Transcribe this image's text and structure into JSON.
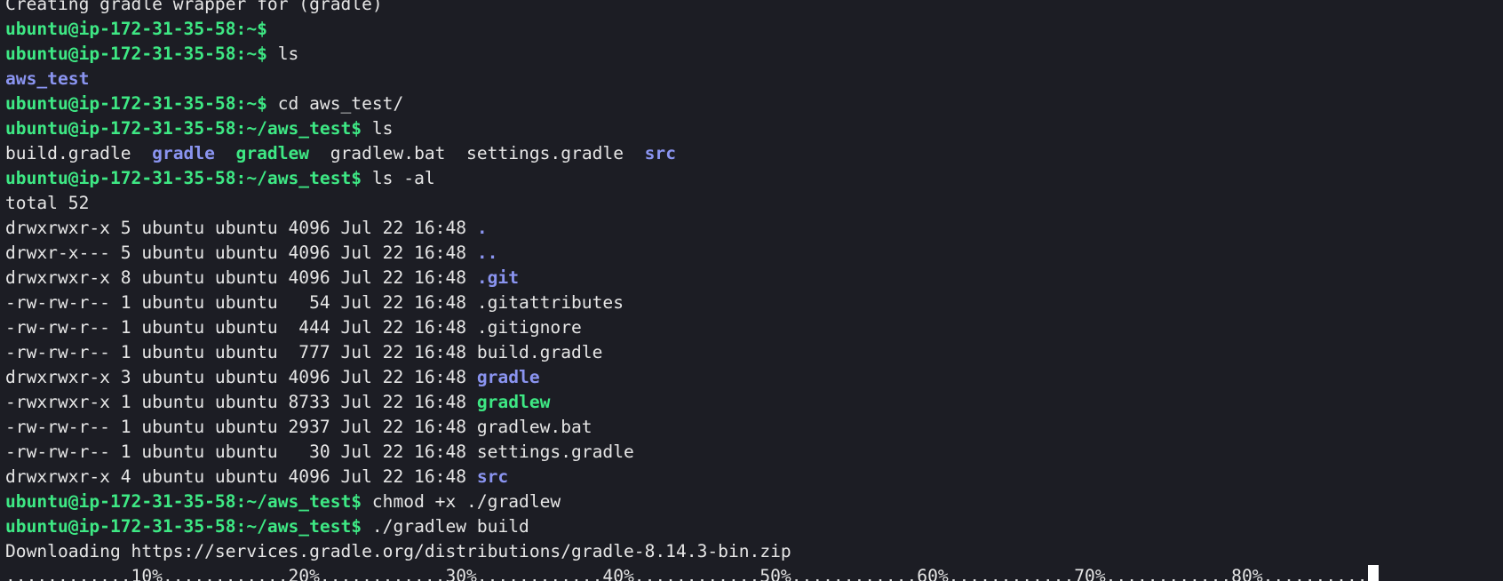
{
  "terminal": {
    "prompt_home": "ubuntu@ip-172-31-35-58:~$",
    "prompt_proj": "ubuntu@ip-172-31-35-58:~/aws_test$",
    "lines": [
      {
        "type": "cut",
        "text": "Creating gradle wrapper for (gradle)"
      },
      {
        "type": "prompt",
        "prompt": "ubuntu@ip-172-31-35-58:~$",
        "cmd": ""
      },
      {
        "type": "prompt",
        "prompt": "ubuntu@ip-172-31-35-58:~$",
        "cmd": " ls"
      },
      {
        "type": "output",
        "segments": [
          {
            "text": "aws_test",
            "style": "dir"
          }
        ]
      },
      {
        "type": "prompt",
        "prompt": "ubuntu@ip-172-31-35-58:~$",
        "cmd": " cd aws_test/"
      },
      {
        "type": "prompt",
        "prompt": "ubuntu@ip-172-31-35-58:~/aws_test$",
        "cmd": " ls"
      },
      {
        "type": "output",
        "segments": [
          {
            "text": "build.gradle  ",
            "style": "plain"
          },
          {
            "text": "gradle",
            "style": "dir"
          },
          {
            "text": "  ",
            "style": "plain"
          },
          {
            "text": "gradlew",
            "style": "exec"
          },
          {
            "text": "  gradlew.bat  settings.gradle  ",
            "style": "plain"
          },
          {
            "text": "src",
            "style": "dir"
          }
        ]
      },
      {
        "type": "prompt",
        "prompt": "ubuntu@ip-172-31-35-58:~/aws_test$",
        "cmd": " ls -al"
      },
      {
        "type": "output",
        "segments": [
          {
            "text": "total 52",
            "style": "plain"
          }
        ]
      },
      {
        "type": "listing",
        "meta": "drwxrwxr-x 5 ubuntu ubuntu 4096 Jul 22 16:48 ",
        "name": ".",
        "style": "dir"
      },
      {
        "type": "listing",
        "meta": "drwxr-x--- 5 ubuntu ubuntu 4096 Jul 22 16:48 ",
        "name": "..",
        "style": "dir"
      },
      {
        "type": "listing",
        "meta": "drwxrwxr-x 8 ubuntu ubuntu 4096 Jul 22 16:48 ",
        "name": ".git",
        "style": "dir"
      },
      {
        "type": "listing",
        "meta": "-rw-rw-r-- 1 ubuntu ubuntu   54 Jul 22 16:48 ",
        "name": ".gitattributes",
        "style": "plain"
      },
      {
        "type": "listing",
        "meta": "-rw-rw-r-- 1 ubuntu ubuntu  444 Jul 22 16:48 ",
        "name": ".gitignore",
        "style": "plain"
      },
      {
        "type": "listing",
        "meta": "-rw-rw-r-- 1 ubuntu ubuntu  777 Jul 22 16:48 ",
        "name": "build.gradle",
        "style": "plain"
      },
      {
        "type": "listing",
        "meta": "drwxrwxr-x 3 ubuntu ubuntu 4096 Jul 22 16:48 ",
        "name": "gradle",
        "style": "dir"
      },
      {
        "type": "listing",
        "meta": "-rwxrwxr-x 1 ubuntu ubuntu 8733 Jul 22 16:48 ",
        "name": "gradlew",
        "style": "exec"
      },
      {
        "type": "listing",
        "meta": "-rw-rw-r-- 1 ubuntu ubuntu 2937 Jul 22 16:48 ",
        "name": "gradlew.bat",
        "style": "plain"
      },
      {
        "type": "listing",
        "meta": "-rw-rw-r-- 1 ubuntu ubuntu   30 Jul 22 16:48 ",
        "name": "settings.gradle",
        "style": "plain"
      },
      {
        "type": "listing",
        "meta": "drwxrwxr-x 4 ubuntu ubuntu 4096 Jul 22 16:48 ",
        "name": "src",
        "style": "dir"
      },
      {
        "type": "prompt",
        "prompt": "ubuntu@ip-172-31-35-58:~/aws_test$",
        "cmd": " chmod +x ./gradlew"
      },
      {
        "type": "prompt",
        "prompt": "ubuntu@ip-172-31-35-58:~/aws_test$",
        "cmd": " ./gradlew build"
      },
      {
        "type": "output",
        "segments": [
          {
            "text": "Downloading https://services.gradle.org/distributions/gradle-8.14.3-bin.zip",
            "style": "plain"
          }
        ]
      },
      {
        "type": "progress",
        "text": "............10%............20%............30%............40%............50%............60%............70%............80%.........."
      }
    ]
  },
  "colors": {
    "background": "#1c1d24",
    "prompt": "#3ee884",
    "directory": "#8a94f0",
    "text": "#e6e6e6",
    "cursor": "#ffffff"
  }
}
